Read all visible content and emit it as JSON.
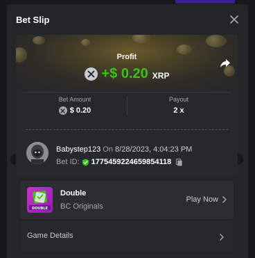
{
  "header": {
    "title": "Bet Slip"
  },
  "icons": {
    "close": "close-icon",
    "share": "share-arrow-icon",
    "currency": "xrp-icon",
    "verified": "verified-shield-icon",
    "copy": "copy-icon",
    "chevron": "chevron-right-icon"
  },
  "profit": {
    "label": "Profit",
    "value": "+$ 0.20",
    "currency": "XRP"
  },
  "summary": {
    "bet_amount_label": "Bet Amount",
    "bet_amount_value": "$ 0.20",
    "payout_label": "Payout",
    "payout_value": "2 x"
  },
  "bet": {
    "username": "Babystep123",
    "on_text": "On",
    "timestamp": "8/28/2023, 4:04:23 PM",
    "bet_id_label": "Bet ID:",
    "bet_id_value": "1775459224659854118"
  },
  "game": {
    "name": "Double",
    "provider": "BC Originals",
    "thumb_text": "DOUBLE",
    "play_label": "Play Now"
  },
  "details": {
    "label": "Game Details"
  },
  "colors": {
    "accent_green": "#3bc117",
    "modal_bg": "#232529",
    "page_bg": "#17181b",
    "thumb_magenta": "#d22fc4"
  }
}
